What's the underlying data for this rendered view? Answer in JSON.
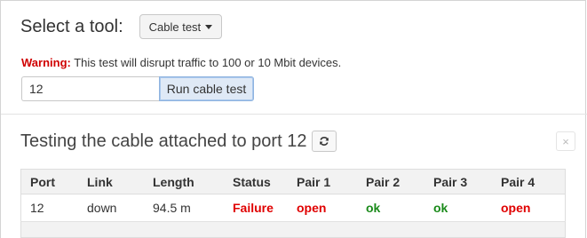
{
  "tool_selector": {
    "label": "Select a tool:",
    "selected": "Cable test"
  },
  "warning": {
    "prefix": "Warning:",
    "text": " This test will disrupt traffic to 100 or 10 Mbit devices."
  },
  "port_input": {
    "value": "12"
  },
  "run_button": {
    "label": "Run cable test"
  },
  "results": {
    "title": "Testing the cable attached to port 12",
    "refresh_icon": "refresh-icon",
    "close_label": "×",
    "columns": [
      "Port",
      "Link",
      "Length",
      "Status",
      "Pair 1",
      "Pair 2",
      "Pair 3",
      "Pair 4"
    ],
    "row": {
      "port": "12",
      "link": "down",
      "length": "94.5 m",
      "status": "Failure",
      "pair1": "open",
      "pair2": "ok",
      "pair3": "ok",
      "pair4": "open"
    }
  },
  "colors": {
    "error": "#e00000",
    "ok": "#1a8a1a",
    "warning": "#d00000"
  }
}
